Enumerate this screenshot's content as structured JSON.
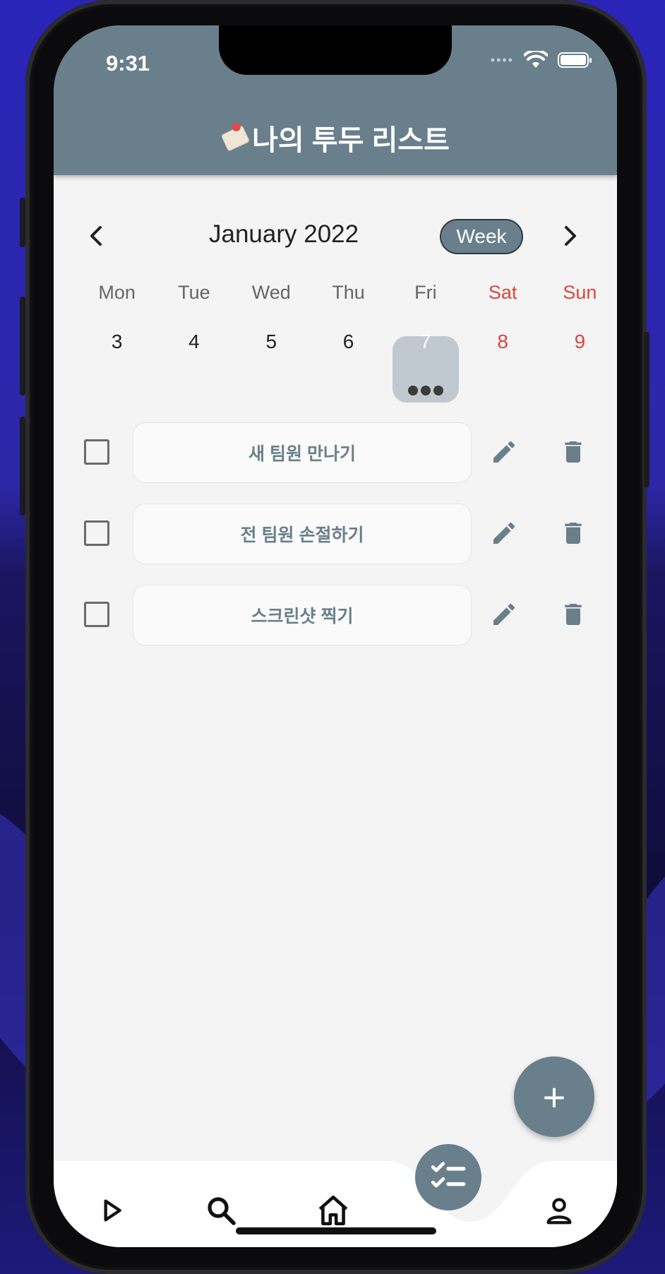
{
  "status_bar": {
    "time": "9:31"
  },
  "app": {
    "title": "나의 투두 리스트"
  },
  "calendar": {
    "month_label": "January 2022",
    "view_toggle": "Week",
    "days": [
      {
        "dow": "Mon",
        "date": "3"
      },
      {
        "dow": "Tue",
        "date": "4"
      },
      {
        "dow": "Wed",
        "date": "5"
      },
      {
        "dow": "Thu",
        "date": "6"
      },
      {
        "dow": "Fri",
        "date": "7"
      },
      {
        "dow": "Sat",
        "date": "8"
      },
      {
        "dow": "Sun",
        "date": "9"
      }
    ],
    "selected_day": "7",
    "weekend_color": "#d9483b"
  },
  "todos": [
    {
      "label": "새 팀원 만나기",
      "checked": false
    },
    {
      "label": "전 팀원 손절하기",
      "checked": false
    },
    {
      "label": "스크린샷 찍기",
      "checked": false
    }
  ],
  "colors": {
    "accent": "#697f8c",
    "background": "#f4f4f4",
    "selected_day_bg": "#c0c9cf"
  },
  "fab": {
    "label": "+"
  },
  "bottom_nav": {
    "items": [
      "play-icon",
      "search-icon",
      "home-icon",
      "checklist-icon",
      "person-icon"
    ],
    "active": "checklist-icon"
  }
}
